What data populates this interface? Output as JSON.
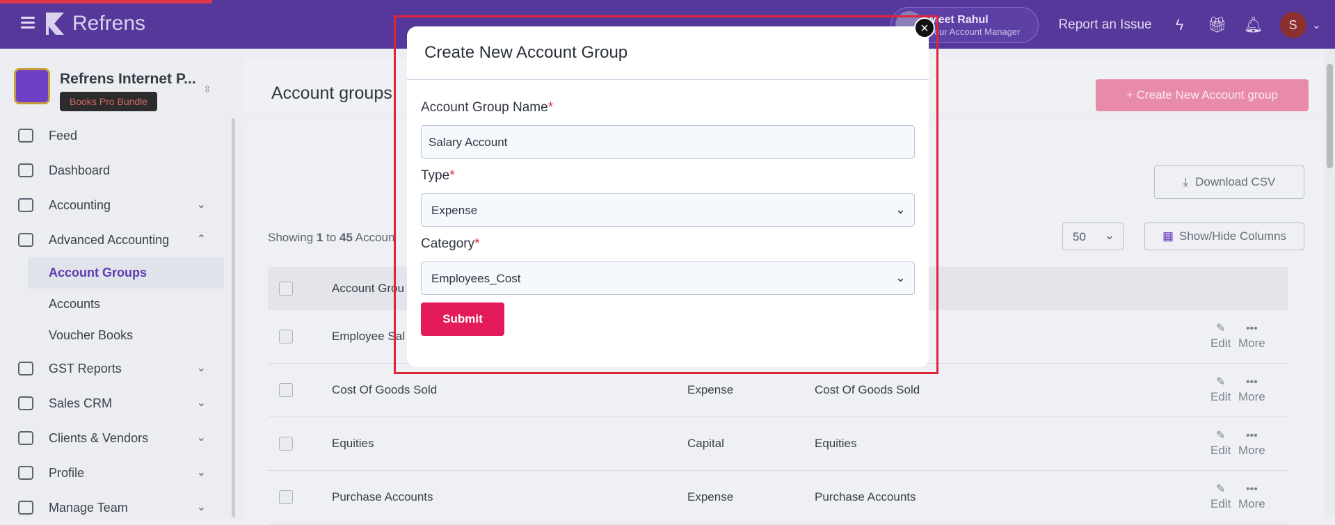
{
  "topbar": {
    "brand": "Refrens",
    "manager_name": "Meet Rahul",
    "manager_role": "Your Account Manager",
    "report_issue": "Report an Issue",
    "user_initial": "S",
    "colors": {
      "bar": "#55389a",
      "accent": "#e31b5b"
    }
  },
  "sidebar": {
    "org_name": "Refrens Internet P...",
    "org_badge": "Books Pro Bundle",
    "items": [
      {
        "label": "Feed",
        "icon": "feed-icon",
        "chevron": ""
      },
      {
        "label": "Dashboard",
        "icon": "dashboard-icon",
        "chevron": ""
      },
      {
        "label": "Accounting",
        "icon": "accounting-icon",
        "chevron": "⌄"
      },
      {
        "label": "Advanced Accounting",
        "icon": "advanced-accounting-icon",
        "chevron": "⌃"
      }
    ],
    "subitems": [
      {
        "label": "Account Groups",
        "active": true
      },
      {
        "label": "Accounts",
        "active": false
      },
      {
        "label": "Voucher Books",
        "active": false
      }
    ],
    "items2": [
      {
        "label": "GST Reports",
        "icon": "gst-icon"
      },
      {
        "label": "Sales CRM",
        "icon": "crm-icon"
      },
      {
        "label": "Clients & Vendors",
        "icon": "clients-icon"
      },
      {
        "label": "Profile",
        "icon": "profile-icon"
      },
      {
        "label": "Manage Team",
        "icon": "team-icon"
      }
    ]
  },
  "main": {
    "page_title": "Account groups",
    "create_button": "+ Create New Account group",
    "download_csv": "Download CSV",
    "showing_prefix": "Showing ",
    "showing_from": "1",
    "showing_to_word": " to ",
    "showing_to": "45",
    "showing_suffix": " Accoun",
    "per_page": "50",
    "show_hide_columns": "Show/Hide Columns",
    "table": {
      "header_name": "Account Grou",
      "rows": [
        {
          "name": "Employee Sal",
          "type": "",
          "category": ""
        },
        {
          "name": "Cost Of Goods Sold",
          "type": "Expense",
          "category": "Cost Of Goods Sold"
        },
        {
          "name": "Equities",
          "type": "Capital",
          "category": "Equities"
        },
        {
          "name": "Purchase Accounts",
          "type": "Expense",
          "category": "Purchase Accounts"
        }
      ],
      "edit_label": "Edit",
      "more_label": "More"
    }
  },
  "modal": {
    "title": "Create New Account Group",
    "name_label": "Account Group Name",
    "name_value": "Salary Account",
    "type_label": "Type",
    "type_value": "Expense",
    "category_label": "Category",
    "category_value": "Employees_Cost",
    "required_mark": "*",
    "submit": "Submit",
    "close": "×"
  }
}
